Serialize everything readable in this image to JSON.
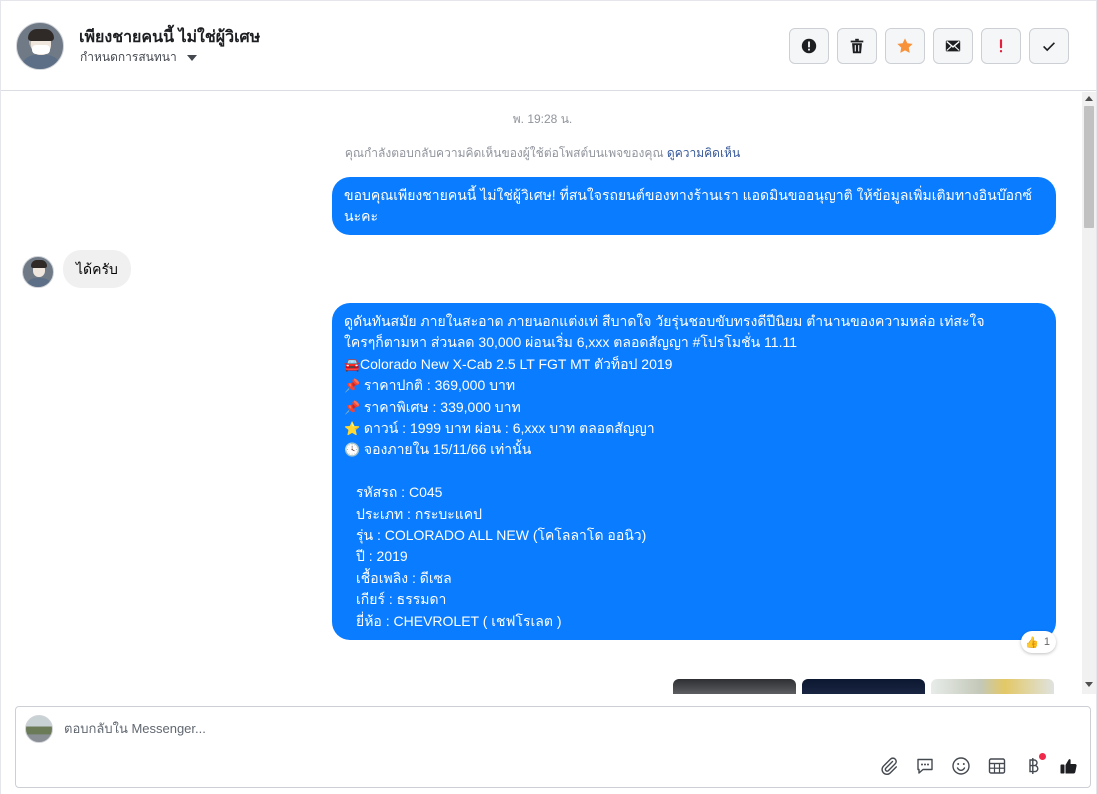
{
  "header": {
    "contact_name": "เพียงชายคนนี้ ไม่ใช่ผู้วิเศษ",
    "assign_label": "กำหนดการสนทนา",
    "actions": [
      {
        "name": "spam-button",
        "icon": "alert-circle-icon"
      },
      {
        "name": "delete-button",
        "icon": "trash-icon"
      },
      {
        "name": "star-button",
        "icon": "star-icon",
        "color": "#f7923b"
      },
      {
        "name": "mark-unread-button",
        "icon": "envelope-icon"
      },
      {
        "name": "follow-up-button",
        "icon": "exclamation-icon",
        "color": "#e41e3f"
      },
      {
        "name": "done-button",
        "icon": "check-icon"
      }
    ]
  },
  "conversation": {
    "timestamp": "พ. 19:28 น.",
    "reply_note": "คุณกำลังตอบกลับความคิดเห็นของผู้ใช้ต่อโพสต์บนเพจของคุณ",
    "reply_note_link": "ดูความคิดเห็น",
    "message_1": "ขอบคุณเพียงชายคนนี้ ไม่ใช่ผู้วิเศษ! ที่สนใจรถยนต์ของทางร้านเรา แอดมินขออนุญาติ ให้ข้อมูลเพิ่มเติมทางอินบ๊อกซ์นะคะ",
    "incoming_1": "ได้ครับ",
    "message_2": {
      "intro_1": "ดูดันทันสมัย ภายในสะอาด ภายนอกแต่งเท่ สีบาดใจ วัยรุ่นชอบขับทรงดีปีนิยม ตำนานของความหล่อ เท่สะใจ",
      "intro_2": "ใครๆก็ตามหา ส่วนลด 30,000 ผ่อนเริ่ม 6,xxx ตลอดสัญญา #โปรโมชั่น 11.11",
      "model_emoji": "🚘",
      "model": "Colorado New X-Cab 2.5 LT FGT MT ตัวท็อป 2019",
      "pin_emoji": "📌",
      "normal_price": "ราคาปกติ : 369,000 บาท",
      "special_price": "ราคาพิเศษ : 339,000 บาท",
      "star_emoji": "⭐",
      "down_payment": "ดาวน์ : 1999 บาท ผ่อน : 6,xxx บาท ตลอดสัญญา",
      "clock_emoji": "🕓",
      "booking": "จองภายใน 15/11/66 เท่านั้น",
      "code": "รหัสรถ : C045",
      "type": "ประเภท : กระบะแคป",
      "series": "รุ่น : COLORADO ALL NEW (โคโลลาโด ออนิว)",
      "year": "ปี : 2019",
      "fuel": "เชื้อเพลิง : ดีเซล",
      "gear": "เกียร์ : ธรรมดา",
      "brand": "ยี่ห้อ : CHEVROLET ( เชฟโรเลต )"
    },
    "reaction": {
      "emoji": "👍",
      "count": "1"
    }
  },
  "composer": {
    "placeholder": "ตอบกลับใน Messenger...",
    "tools": [
      "attachment-icon",
      "saved-reply-icon",
      "emoji-icon",
      "calendar-icon",
      "baht-payment-icon",
      "thumbs-up-icon"
    ],
    "accent": "#0a7cff"
  }
}
